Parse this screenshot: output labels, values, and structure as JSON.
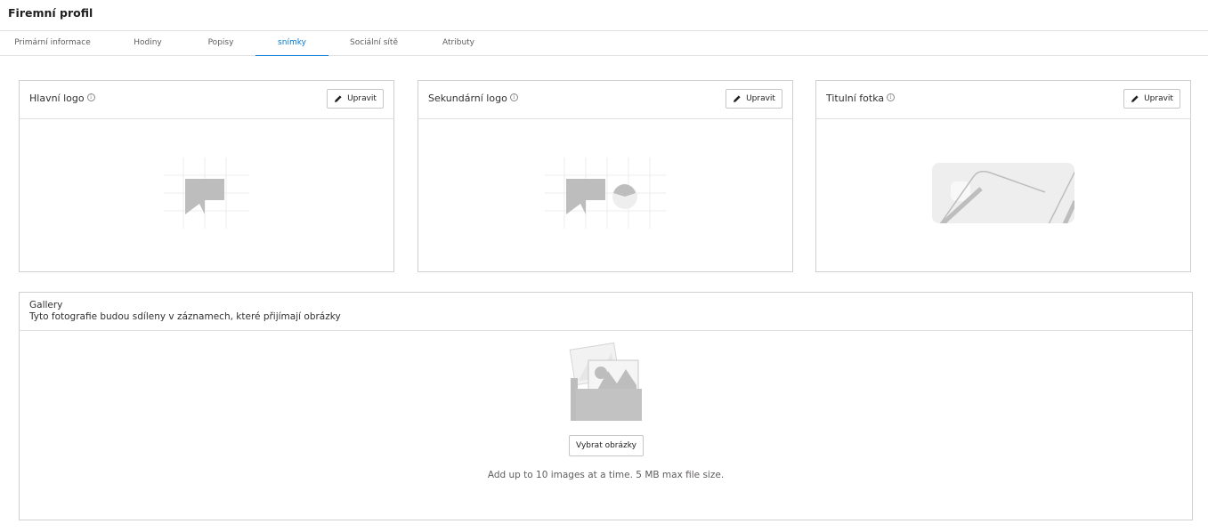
{
  "page": {
    "title": "Firemní profil"
  },
  "tabs": [
    {
      "label": "Primární informace"
    },
    {
      "label": "Hodiny"
    },
    {
      "label": "Popisy"
    },
    {
      "label": "snímky",
      "active": true
    },
    {
      "label": "Sociální sítě"
    },
    {
      "label": "Atributy"
    }
  ],
  "cards": [
    {
      "title": "Hlavní logo",
      "edit_label": "Upravit",
      "icon": "logo-placeholder-icon"
    },
    {
      "title": "Sekundární logo",
      "edit_label": "Upravit",
      "icon": "secondary-logo-placeholder-icon"
    },
    {
      "title": "Titulní fotka",
      "edit_label": "Upravit",
      "icon": "cover-photo-placeholder-icon"
    }
  ],
  "gallery": {
    "title": "Gallery",
    "subtitle": "Tyto fotografie budou sdíleny v záznamech, které přijímají obrázky",
    "select_label": "Vybrat obrázky",
    "hint": "Add up to 10 images at a time. 5 MB max file size."
  },
  "colors": {
    "accent": "#0078d4",
    "border": "#d2d0ce",
    "placeholder": "#bdbdbd"
  }
}
